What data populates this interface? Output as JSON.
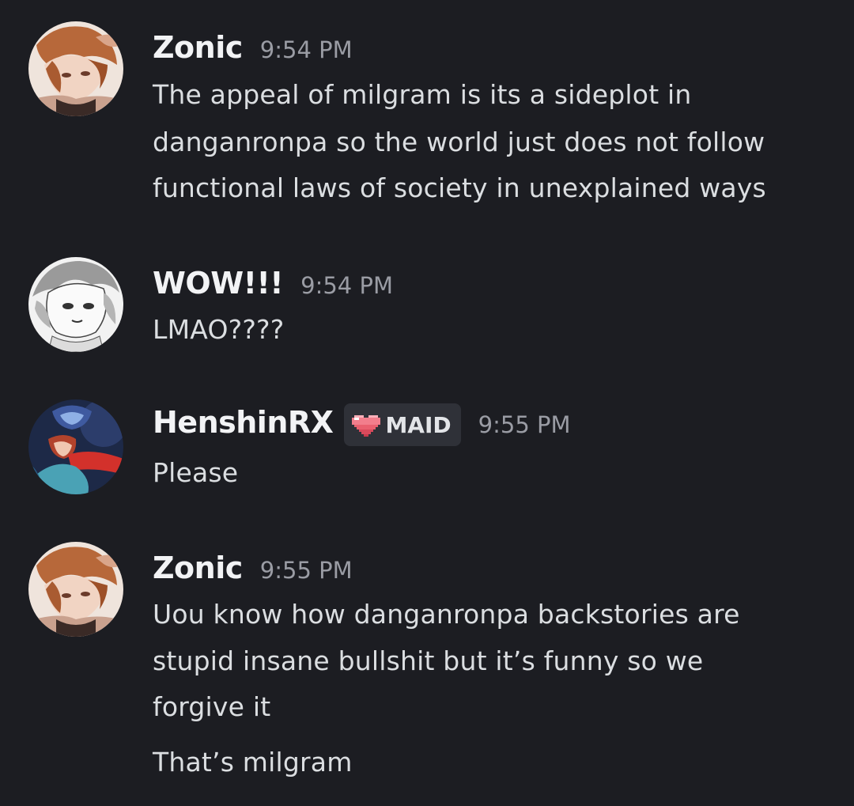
{
  "messages": [
    {
      "username": "Zonic",
      "time": "9:54 PM",
      "lines": [
        "The appeal of milgram is its a sideplot in",
        "danganronpa so the world just does not follow",
        "functional laws of society in unexplained ways"
      ]
    },
    {
      "username": "WOW!!!",
      "time": "9:54 PM",
      "lines": [
        "LMAO????"
      ]
    },
    {
      "username": "HenshinRX",
      "tag": {
        "label": "MAID",
        "icon": "pixel-heart-icon",
        "color": "#f27e8c"
      },
      "time": "9:55 PM",
      "lines": [
        "Please"
      ]
    },
    {
      "username": "Zonic",
      "time": "9:55 PM",
      "lines": [
        "Uou know how danganronpa backstories are",
        "stupid insane bullshit but it’s funny so we",
        "forgive it"
      ],
      "followup": "That’s milgram"
    }
  ],
  "colors": {
    "background": "#1c1d22",
    "username": "#f2f3f5",
    "timestamp": "#9a9ca4",
    "message_text": "#dbdee1",
    "tag_background": "#2f3138"
  }
}
